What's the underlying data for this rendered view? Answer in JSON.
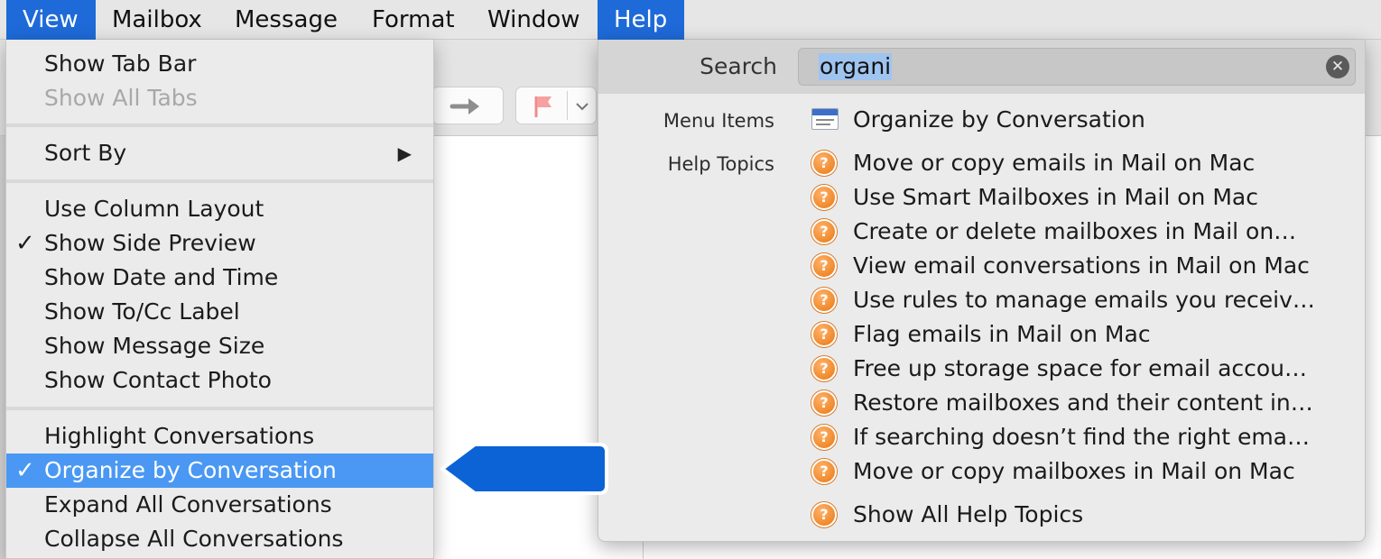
{
  "menubar": {
    "items": [
      {
        "label": "View",
        "active": true
      },
      {
        "label": "Mailbox",
        "active": false
      },
      {
        "label": "Message",
        "active": false
      },
      {
        "label": "Format",
        "active": false
      },
      {
        "label": "Window",
        "active": false
      },
      {
        "label": "Help",
        "active": true
      }
    ]
  },
  "view_menu": {
    "show_tab_bar": "Show Tab Bar",
    "show_all_tabs": "Show All Tabs",
    "sort_by": "Sort By",
    "use_column_layout": "Use Column Layout",
    "show_side_preview": "Show Side Preview",
    "show_date_and_time": "Show Date and Time",
    "show_to_cc_label": "Show To/Cc Label",
    "show_message_size": "Show Message Size",
    "show_contact_photo": "Show Contact Photo",
    "highlight_conversations": "Highlight Conversations",
    "organize_by_conversation": "Organize by Conversation",
    "expand_all_conversations": "Expand All Conversations",
    "collapse_all_conversations": "Collapse All Conversations",
    "checkmark": "✓",
    "submenu_arrow": "▶"
  },
  "help_menu": {
    "search_label": "Search",
    "search_value": "organi",
    "clear_glyph": "✕",
    "menu_items_label": "Menu Items",
    "help_topics_label": "Help Topics",
    "menu_results": [
      "Organize by Conversation"
    ],
    "help_topics": [
      "Move or copy emails in Mail on Mac",
      "Use Smart Mailboxes in Mail on Mac",
      "Create or delete mailboxes in Mail on…",
      "View email conversations in Mail on Mac",
      "Use rules to manage emails you receiv…",
      "Flag emails in Mail on Mac",
      "Free up storage space for email accou…",
      "Restore mailboxes and their content in…",
      "If searching doesn’t find the right ema…",
      "Move or copy mailboxes in Mail on Mac"
    ],
    "show_all": "Show All Help Topics",
    "help_icon_glyph": "?"
  },
  "colors": {
    "menubar_active": "#1e6ad8",
    "selected_item": "#4a98f3",
    "callout": "#0b63d6",
    "help_icon": "#f18a2d"
  },
  "icons": {
    "menu_result_icon": "mail-window-icon",
    "help_topic_icon": "help-question-icon",
    "toolbar_forward": "arrow-right-icon",
    "toolbar_flag": "flag-icon"
  }
}
